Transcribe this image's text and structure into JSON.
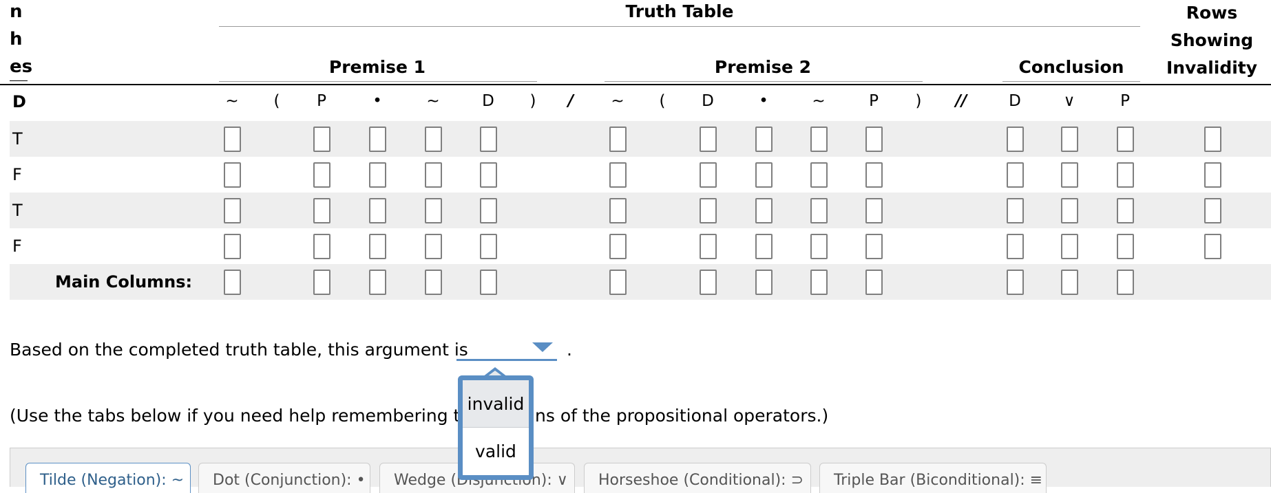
{
  "left_headers": [
    "n",
    "h",
    "es"
  ],
  "headers": {
    "truth_table": "Truth Table",
    "premise1": "Premise 1",
    "premise2": "Premise 2",
    "conclusion": "Conclusion",
    "rows_showing_invalidity": [
      "Rows",
      "Showing",
      "Invalidity"
    ]
  },
  "columns": {
    "first": "D",
    "symbols": [
      "~",
      "(",
      "P",
      "•",
      "~",
      "D",
      ")",
      "/",
      "~",
      "(",
      "D",
      "•",
      "~",
      "P",
      ")",
      "//",
      "D",
      "∨",
      "P"
    ]
  },
  "rows": [
    "T",
    "F",
    "T",
    "F"
  ],
  "main_columns_label": "Main Columns:",
  "sentence": {
    "before": "Based on the completed truth table, this argument is",
    "after": "."
  },
  "dropdown": {
    "selected": "",
    "options": [
      "invalid",
      "valid"
    ],
    "highlighted": "invalid"
  },
  "help_text": "(Use the tabs below if you need help remembering th",
  "help_text_end": "ns of the propositional operators.)",
  "tabs": [
    "Tilde (Negation): ~",
    "Dot (Conjunction): •",
    "Wedge (Disjunction): ∨",
    "Horseshoe (Conditional): ⊃",
    "Triple Bar (Biconditional): ≡"
  ],
  "colors": {
    "accent": "#5a8ec4",
    "band": "#eeeeee"
  }
}
